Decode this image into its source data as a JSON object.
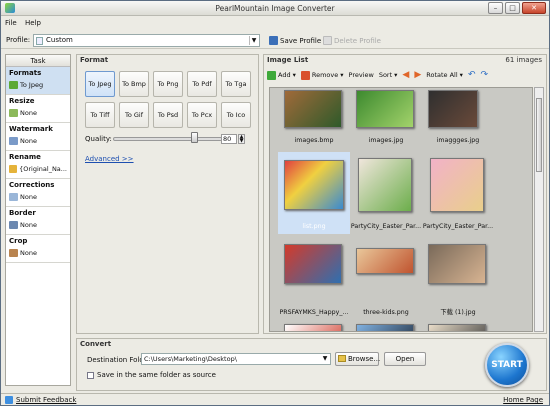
{
  "window": {
    "title": "PearlMountain Image Converter"
  },
  "menu": {
    "file": "File",
    "help": "Help"
  },
  "profile": {
    "label": "Profile:",
    "value": "Custom",
    "save": "Save Profile",
    "delete": "Delete Profile"
  },
  "task": {
    "header": "Task",
    "sections": [
      {
        "title": "Formats",
        "sub": "To Jpeg"
      },
      {
        "title": "Resize",
        "sub": "None"
      },
      {
        "title": "Watermark",
        "sub": "None"
      },
      {
        "title": "Rename",
        "sub": "{Original_Na..."
      },
      {
        "title": "Corrections",
        "sub": "None"
      },
      {
        "title": "Border",
        "sub": "None"
      },
      {
        "title": "Crop",
        "sub": "None"
      }
    ]
  },
  "format": {
    "header": "Format",
    "buttons": [
      "To Jpeg",
      "To Bmp",
      "To Png",
      "To Pdf",
      "To Tga",
      "To Tiff",
      "To Gif",
      "To Psd",
      "To Pcx",
      "To Ico"
    ],
    "quality_label": "Quality:",
    "quality": "80",
    "advanced": "Advanced >>"
  },
  "images": {
    "header": "Image List",
    "count": "61 images",
    "toolbar": {
      "add": "Add",
      "remove": "Remove",
      "preview": "Preview",
      "sort": "Sort",
      "rotate_all": "Rotate All"
    },
    "items": [
      {
        "name": "images.bmp",
        "colors": [
          "#a06a3a",
          "#2e5a2a"
        ]
      },
      {
        "name": "images.jpg",
        "colors": [
          "#3d8a2f",
          "#a3d36b"
        ]
      },
      {
        "name": "imaggges.jpg",
        "colors": [
          "#2f2f2f",
          "#6a4a3a"
        ]
      },
      {
        "name": "list.png",
        "colors": [
          "#e04040",
          "#3a8ad0"
        ]
      },
      {
        "name": "PartyCity_Easter_Par...",
        "colors": [
          "#f0e6dc",
          "#6cae4b"
        ]
      },
      {
        "name": "PartyCity_Easter_Par...",
        "colors": [
          "#f2b2c8",
          "#e9cf8b"
        ]
      },
      {
        "name": "PRSFAYMKS_Happy_...",
        "colors": [
          "#d43a2a",
          "#2f6fb0"
        ]
      },
      {
        "name": "three-kids.png",
        "colors": [
          "#e9c79a",
          "#c0542f"
        ]
      },
      {
        "name": "下载 (1).jpg",
        "colors": [
          "#7a6a5a",
          "#d8b492"
        ]
      },
      {
        "name": "",
        "colors": [
          "#ffffff",
          "#d04030"
        ]
      },
      {
        "name": "",
        "colors": [
          "#7fb0e0",
          "#1e2a3a"
        ]
      },
      {
        "name": "",
        "colors": [
          "#e8dcc8",
          "#3a3a3a"
        ]
      }
    ]
  },
  "convert": {
    "header": "Convert",
    "dest_label": "Destination Folder:",
    "dest_value": "C:\\Users\\Marketing\\Desktop\\",
    "browse": "Browse...",
    "open": "Open",
    "same_folder": "Save in the same folder as source",
    "start": "START"
  },
  "status": {
    "feedback": "Submit Feedback",
    "home": "Home Page"
  }
}
